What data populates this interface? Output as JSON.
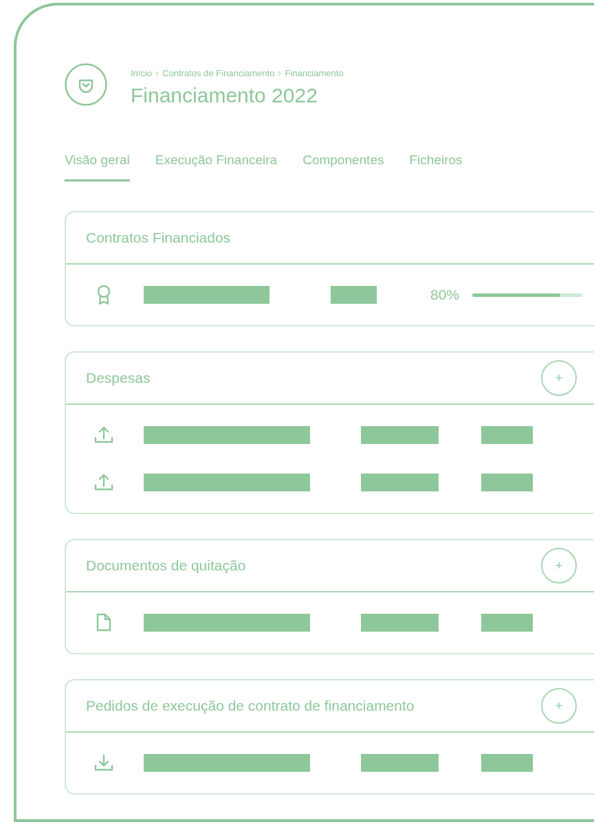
{
  "breadcrumb": [
    "Início",
    "Contratos de Financiamento",
    "Financiamento"
  ],
  "title": "Financiamento 2022",
  "tabs": [
    {
      "label": "Visão geral",
      "selected": true
    },
    {
      "label": "Execução Financeira",
      "selected": false
    },
    {
      "label": "Componentes",
      "selected": false
    },
    {
      "label": "Ficheiros",
      "selected": false
    }
  ],
  "sections": [
    {
      "title": "Contratos Financiados",
      "rows": [
        {
          "kind": "award",
          "progress": {
            "reading": "80%",
            "level": 0.8
          }
        }
      ]
    },
    {
      "title": "Despesas",
      "add_label": "+",
      "rows": [
        {
          "kind": "upload"
        },
        {
          "kind": "upload"
        }
      ]
    },
    {
      "title": "Documentos de quitação",
      "add_label": "+",
      "rows": [
        {
          "kind": "file"
        }
      ]
    },
    {
      "title": "Pedidos de execução de contrato de financiamento",
      "add_label": "+",
      "rows": [
        {
          "kind": "download"
        }
      ]
    }
  ]
}
